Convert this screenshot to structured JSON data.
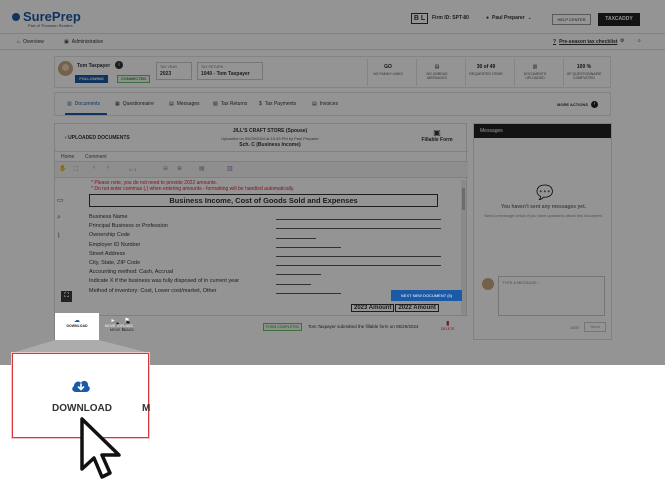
{
  "app": {
    "logo": "SurePrep",
    "logo_sub": "Part of Thomson Reuters",
    "bl_badge": "B L",
    "firm_id": "Firm ID: SPT-80",
    "user": "Paul Preparer",
    "help": "HELP CENTER",
    "taxcaddy": "TAXCADDY"
  },
  "nav": {
    "overview": "Overview",
    "administrative": "Administrative",
    "checklist": "Pre-season tax checklist"
  },
  "client": {
    "name": "Tom Taxpayer",
    "following": "FOLLOWING",
    "connected": "CONNECTED",
    "tax_year_label": "TAX YEAR",
    "tax_year": "2023",
    "return_label": "TAX RETURN",
    "return": "1040 - Tom Taxpayer",
    "stats": [
      {
        "value": "GO",
        "label": "NO FAMILY LINKS"
      },
      {
        "value": "",
        "label": "NO UNREAD MESSAGES"
      },
      {
        "value": "30 of 49",
        "label": "REQUESTED ITEMS"
      },
      {
        "value": "",
        "label": "DOCUMENTS UPLOADED"
      },
      {
        "value": "100 %",
        "label": "OF QUESTIONNAIRE COMPLETED"
      }
    ]
  },
  "tabs": [
    "Documents",
    "Questionnaire",
    "Messages",
    "Tax Returns",
    "Tax Payments",
    "Invoices"
  ],
  "more_actions": "MORE ACTIONS",
  "doc": {
    "back": "UPLOADED DOCUMENTS",
    "title": "JILL'S CRAFT STORE (Spouse)",
    "uploaded": "Uploaded on 05/29/2024 at 10:33 PM by Paul Preparer",
    "schedule": "Sch. C (Business Income)",
    "fillable": "Fillable Form",
    "subtabs": [
      "Home",
      "Comment"
    ],
    "page_indicator": "1 / 1",
    "warnings": [
      "* Please note, you do not need to provide 2022 amounts.",
      "* Do not enter commas (,) when entering amounts - formatting will be handled automatically."
    ],
    "form_title": "Business Income, Cost of Goods Sold and Expenses",
    "rows": [
      "Business Name",
      "Principal Business or Profession",
      "Ownership Code",
      "Employer ID Number",
      "Street Address",
      "City, State, ZIP Code",
      "Accounting method: Cash, Accrual",
      "Indicate X if the business was fully disposed of in current year",
      "Method of inventory: Cost, Lower cost/market, Other"
    ],
    "amount_2023": "2023 Amount",
    "amount_2022": "2022 Amount",
    "next_doc": "NEXT NEW DOCUMENT (5)",
    "footer": {
      "download": "DOWNLOAD",
      "move_to": "MOVE TO",
      "flags": "FLAGS",
      "form_completed": "FORM COMPLETED",
      "submitted": "Tom Taxpayer submitted the fillable form on 05/29/2024",
      "delete": "DELETE"
    }
  },
  "messages": {
    "header": "Messages",
    "empty": "You haven't sent any messages yet.",
    "hint": "Send a message below if you have questions about this document.",
    "placeholder": "TYPE A MESSAGE...",
    "count": "1000",
    "send": "Send"
  },
  "zoom": {
    "label": "DOWNLOAD",
    "next_letter": "M"
  },
  "colors": {
    "accent": "#1a5aa6",
    "highlight": "#d9363e",
    "overlay": "rgba(0,0,0,0.42)"
  }
}
